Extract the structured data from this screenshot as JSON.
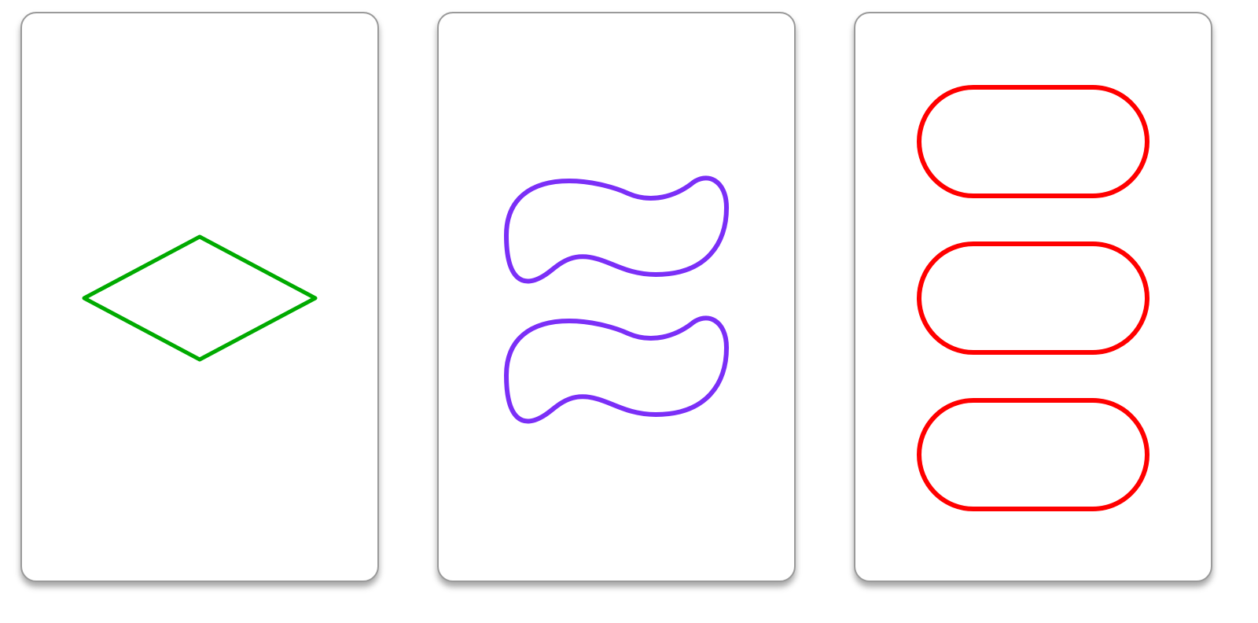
{
  "cards": [
    {
      "number": 1,
      "shape": "diamond",
      "color": "#00aa00",
      "shading": "open"
    },
    {
      "number": 2,
      "shape": "squiggle",
      "color": "#7b2ff7",
      "shading": "open"
    },
    {
      "number": 3,
      "shape": "oval",
      "color": "#ff0000",
      "shading": "open"
    }
  ]
}
